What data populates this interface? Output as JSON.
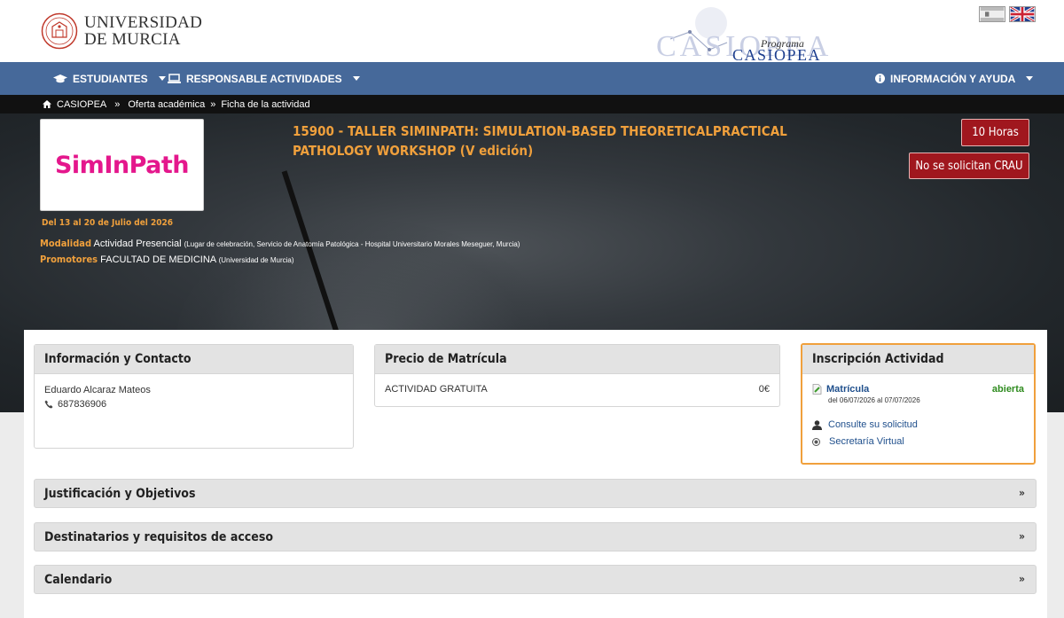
{
  "header": {
    "university_line1": "UNIVERSIDAD",
    "university_line2": "DE MURCIA",
    "program_label": "Programa",
    "program_name": "CASIOPEA",
    "program_watermark": "CASIOPEA"
  },
  "nav": {
    "items": [
      {
        "label": "ESTUDIANTES",
        "icon": "graduation-cap-icon"
      },
      {
        "label": "RESPONSABLE ACTIVIDADES",
        "icon": "laptop-icon"
      },
      {
        "label": "INFORMACIÓN Y AYUDA",
        "icon": "info-icon"
      }
    ]
  },
  "breadcrumb": {
    "home": "CASIOPEA",
    "sep": "»",
    "level2": "Oferta académica",
    "level3": "Ficha de la actividad"
  },
  "activity": {
    "logo_text": "SimInPath",
    "title": "15900 - TALLER SIMINPATH: SIMULATION-BASED THEORETICALPRACTICAL PATHOLOGY WORKSHOP (V edición)",
    "hours": "10 Horas",
    "crau": "No se solicitan CRAU",
    "dates": "Del 13 al 20 de Julio del 2026",
    "modalidad_label": "Modalidad",
    "modalidad_value": "Actividad Presencial",
    "modalidad_detail": "(Lugar de celebración, Servicio de Anatomía Patológica - Hospital Universitario Morales Meseguer, Murcia)",
    "promotores_label": "Promotores",
    "promotores_value": "FACULTAD DE MEDICINA",
    "promotores_detail": "(Universidad de Murcia)"
  },
  "info_card": {
    "title": "Información y Contacto",
    "contact_name": "Eduardo Alcaraz Mateos",
    "phone": "687836906"
  },
  "price_card": {
    "title": "Precio de Matrícula",
    "label": "ACTIVIDAD GRATUITA",
    "amount": "0€"
  },
  "signup_card": {
    "title": "Inscripción Actividad",
    "matricula_label": "Matrícula",
    "matricula_status": "abierta",
    "matricula_dates": "del 06/07/2026 al 07/07/2026",
    "consult_link": "Consulte su solicitud",
    "secretaria_link": "Secretaría Virtual"
  },
  "accordions": [
    {
      "label": "Justificación y Objetivos"
    },
    {
      "label": "Destinatarios y requisitos de acceso"
    },
    {
      "label": "Calendario"
    }
  ],
  "accordion_chevron": "»",
  "colors": {
    "nav_bg": "#46699a",
    "accent_orange": "#f0a03c",
    "badge_red": "#a0171e",
    "logo_pink": "#e4178c",
    "status_green": "#2e8b1e",
    "link_blue": "#1f4f8c"
  }
}
